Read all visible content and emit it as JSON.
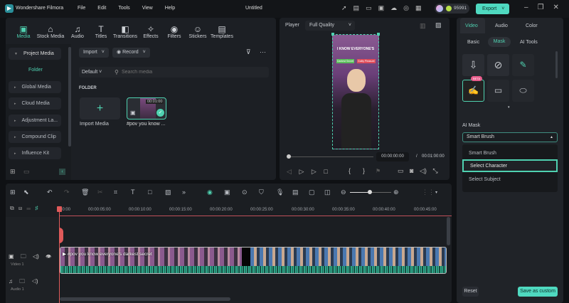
{
  "app": {
    "name": "Wondershare Filmora",
    "title": "Untitled",
    "menu": [
      "File",
      "Edit",
      "Tools",
      "View",
      "Help"
    ],
    "credits": "95991",
    "export": "Export"
  },
  "toolbar": [
    {
      "label": "Media",
      "icon": "media-icon"
    },
    {
      "label": "Stock Media",
      "icon": "stock-icon"
    },
    {
      "label": "Audio",
      "icon": "music-icon"
    },
    {
      "label": "Titles",
      "icon": "text-icon"
    },
    {
      "label": "Transitions",
      "icon": "transition-icon"
    },
    {
      "label": "Effects",
      "icon": "effects-icon"
    },
    {
      "label": "Filters",
      "icon": "filter-icon"
    },
    {
      "label": "Stickers",
      "icon": "sticker-icon"
    },
    {
      "label": "Templates",
      "icon": "template-icon"
    }
  ],
  "sidebar": {
    "project": "Project Media",
    "folder": "Folder",
    "items": [
      "Global Media",
      "Cloud Media",
      "Adjustment La...",
      "Compound Clip",
      "Influence Kit"
    ]
  },
  "media": {
    "import": "Import",
    "record": "Record",
    "sort": "Default",
    "search_placeholder": "Search media",
    "folder_label": "FOLDER",
    "import_media": "Import Media",
    "clip_name": "#pov you know ...",
    "clip_duration": "00:01:00"
  },
  "player": {
    "label": "Player",
    "quality": "Full Quality",
    "current": "00:00:00:00",
    "separator": "/",
    "total": "00:01:00:00",
    "overlay_title": "I KNOW EVERYONE'S",
    "tag1": "Darkest Secret",
    "tag2": "Guilty Pleasure"
  },
  "right": {
    "tabs": [
      "Video",
      "Audio",
      "Color"
    ],
    "subtabs": [
      "Basic",
      "Mask",
      "AI Tools"
    ],
    "beta": "BETA",
    "ai_mask": "AI Mask",
    "selected": "Smart Brush",
    "options": [
      "Smart Brush",
      "Select Character",
      "Select Subject"
    ],
    "reset": "Reset",
    "save": "Save as custom",
    "accent": "#4fd1b0"
  },
  "timeline": {
    "ticks": [
      "00:00",
      "00:00:05:00",
      "00:00:10:00",
      "00:00:15:00",
      "00:00:20:00",
      "00:00:25:00",
      "00:00:30:00",
      "00:00:35:00",
      "00:00:40:00",
      "00:00:45:00"
    ],
    "video_track": "Video 1",
    "audio_track": "Audio 1",
    "clip_title": "#pov you know everyone's darkest secret"
  }
}
